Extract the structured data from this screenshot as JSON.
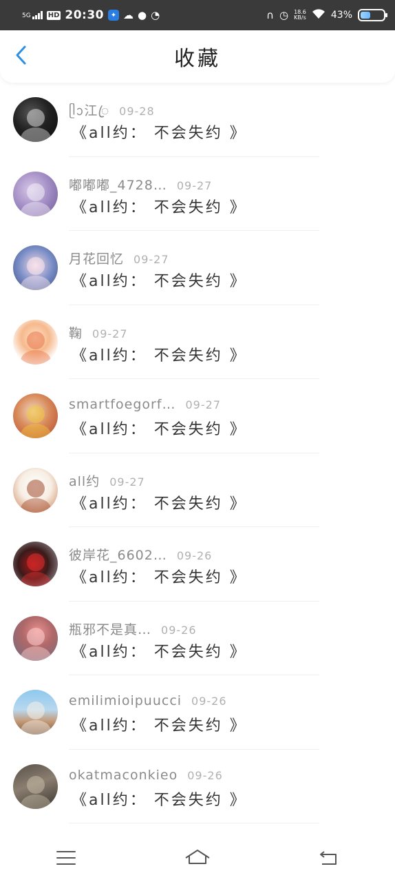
{
  "status_bar": {
    "network": "5G",
    "hd": "HD",
    "time": "20:30",
    "net_speed_value": "18.6",
    "net_speed_unit": "KB/s",
    "battery_percent": "43%",
    "battery_level": 0.43,
    "icons": [
      "signal-icon",
      "app-notification-icon",
      "cloud-icon",
      "chat-icon",
      "compass-icon",
      "headphones-icon",
      "alarm-icon",
      "wifi-icon",
      "battery-icon"
    ]
  },
  "header": {
    "title": "收藏",
    "back_icon": "chevron-left-icon"
  },
  "colors": {
    "accent": "#2b8fe6",
    "status_bar_bg": "#3a3a3a"
  },
  "favorites": [
    {
      "user": "ᥫᩣ江ꦿ",
      "date": "09-28",
      "title": "《all约： 不会失约 》",
      "avatar": {
        "bg": "radial-gradient(circle at 40% 35%, #555 0%, #222 45%, #0b0b0b 100%)",
        "accent": "#d9d9d9"
      }
    },
    {
      "user": "嘟嘟嘟_4728…",
      "date": "09-27",
      "title": "《all约： 不会失约 》",
      "avatar": {
        "bg": "radial-gradient(circle at 40% 40%, #d8c8e8 0%, #9c86c0 55%, #6e5a8e 100%)",
        "accent": "#f3eef8"
      }
    },
    {
      "user": "月花回忆",
      "date": "09-27",
      "title": "《all约： 不会失约 》",
      "avatar": {
        "bg": "radial-gradient(circle at 50% 45%, #f2d7e0 0%, #7b8fc8 50%, #3b4a7a 100%)",
        "accent": "#ffe9f0"
      }
    },
    {
      "user": "鞠",
      "date": "09-27",
      "title": "《all约： 不会失约 》",
      "avatar": {
        "bg": "radial-gradient(circle at 50% 40%, #ffe2c8 0%, #f6b98d 40%, #ffffff 75%)",
        "accent": "#e8774a"
      }
    },
    {
      "user": "smartfoegorf…",
      "date": "09-27",
      "title": "《all约： 不会失约 》",
      "avatar": {
        "bg": "radial-gradient(circle at 45% 40%, #f0d8c0 0%, #d88a5a 45%, #b2452c 100%)",
        "accent": "#f3c43a"
      }
    },
    {
      "user": "all约",
      "date": "09-27",
      "title": "《all约： 不会失约 》",
      "avatar": {
        "bg": "radial-gradient(circle at 50% 40%, #ffffff 0%, #f7eee4 45%, #c97b4e 100%)",
        "accent": "#a1482b"
      }
    },
    {
      "user": "彼岸花_6602…",
      "date": "09-26",
      "title": "《all约： 不会失约 》",
      "avatar": {
        "bg": "radial-gradient(circle at 45% 50%, #b01818 0%, #3a1a1a 45%, #a8a8b0 100%)",
        "accent": "#e23030"
      }
    },
    {
      "user": "瓶邪不是真…",
      "date": "09-26",
      "title": "《all约： 不会失约 》",
      "avatar": {
        "bg": "radial-gradient(circle at 55% 35%, #e89090 0%, #b06868 40%, #6b6b80 100%)",
        "accent": "#ffd0d0"
      }
    },
    {
      "user": "emilimioipuucci",
      "date": "09-26",
      "title": "《all约： 不会失约 》",
      "avatar": {
        "bg": "linear-gradient(180deg, #8fc8ee 0%, #b8d8ee 45%, #c49a78 70%, #7a5a40 100%)",
        "accent": "#f6f0e8"
      }
    },
    {
      "user": "okatmaconkieo",
      "date": "09-26",
      "title": "《all约： 不会失约 》",
      "avatar": {
        "bg": "linear-gradient(160deg, #5a5048 0%, #8a7e70 45%, #3a342e 100%)",
        "accent": "#c8bca8"
      }
    }
  ],
  "nav": {
    "menu_icon": "menu-icon",
    "home_icon": "home-icon",
    "back_icon": "back-icon"
  }
}
